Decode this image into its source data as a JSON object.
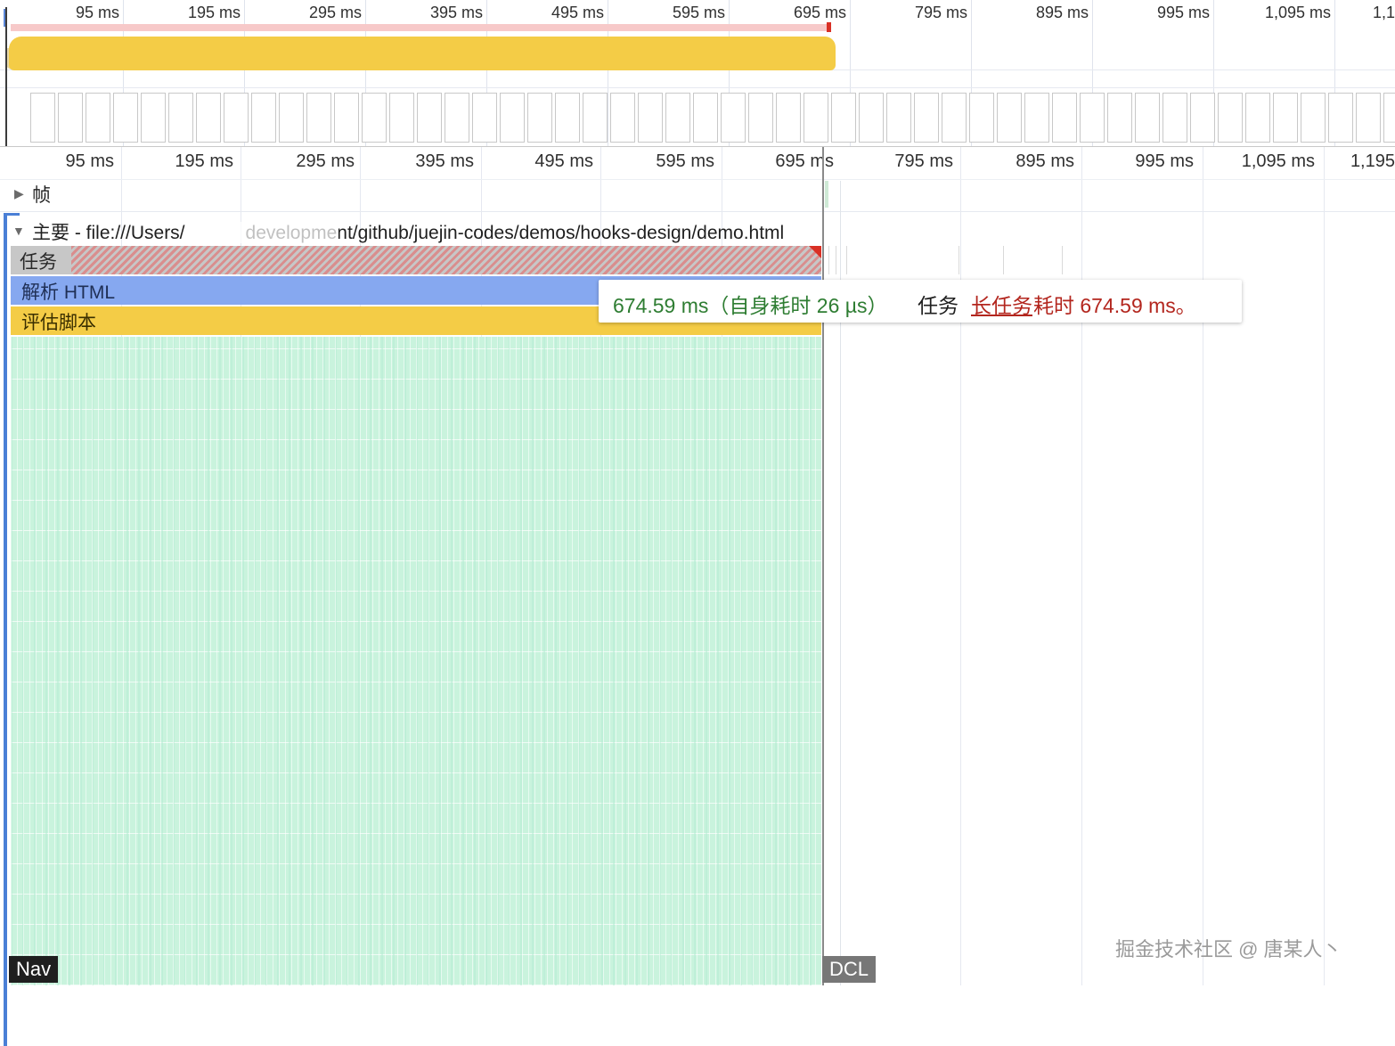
{
  "overview": {
    "ticks": [
      "95 ms",
      "195 ms",
      "295 ms",
      "395 ms",
      "495 ms",
      "595 ms",
      "695 ms",
      "795 ms",
      "895 ms",
      "995 ms",
      "1,095 ms",
      "1,1"
    ]
  },
  "ruler": {
    "ticks": [
      "95 ms",
      "195 ms",
      "295 ms",
      "395 ms",
      "495 ms",
      "595 ms",
      "695 ms",
      "795 ms",
      "895 ms",
      "995 ms",
      "1,095 ms",
      "1,195"
    ]
  },
  "tracks": {
    "frames_label": "帧",
    "main_label": "主要 - file:///Users/",
    "main_url_tail": "development/github/juejin-codes/demos/hooks-design/demo.html"
  },
  "flame": {
    "task": "任务",
    "parse_html": "解析 HTML",
    "evaluate_script": "评估脚本"
  },
  "tooltip": {
    "duration": "674.59 ms（自身耗时 26 µs）",
    "task": "任务",
    "link": "长任务",
    "message": "耗时 674.59 ms。"
  },
  "markers": {
    "nav": "Nav",
    "dcl": "DCL"
  },
  "watermark": "掘金技术社区 @ 唐某人丶",
  "colors": {
    "task": "#c7c7c7",
    "long_task_hatch": "#d98e8e",
    "parse_html": "#86a8f0",
    "evaluate_script": "#f4cc46",
    "function_calls": "#c9f3dd",
    "duration_text": "#2e7d32",
    "warning_text": "#b3261e"
  },
  "icons": {
    "frames_toggle": "triangle-right-icon",
    "main_toggle": "triangle-down-icon"
  }
}
